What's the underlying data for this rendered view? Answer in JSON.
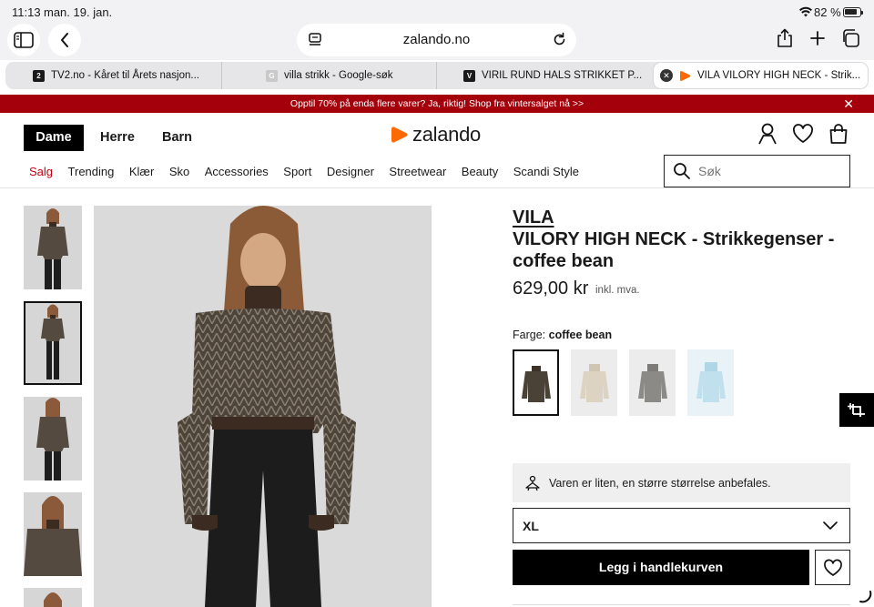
{
  "status": {
    "time": "11:13",
    "date": "man. 19. jan.",
    "battery": "82 %"
  },
  "browser": {
    "url": "zalando.no",
    "tabs": [
      {
        "title": "TV2.no - Kåret til Årets nasjon...",
        "favicon": "2",
        "favicon_color": "#1a1a1a"
      },
      {
        "title": "villa strikk - Google-søk",
        "favicon": "G",
        "favicon_color": "#bdbdbd"
      },
      {
        "title": "VIRIL RUND HALS STRIKKET P...",
        "favicon": "V",
        "favicon_color": "#1a1a1a"
      },
      {
        "title": "VILA VILORY HIGH NECK - Strik...",
        "favicon": "",
        "favicon_color": "#ff6900"
      }
    ]
  },
  "banner": {
    "text": "Opptil 70% på enda flere varer? Ja, riktig! Shop fra vintersalget nå >>",
    "color": "#a4000c"
  },
  "header": {
    "genders": [
      "Dame",
      "Herre",
      "Barn"
    ],
    "logo": "zalando",
    "nav": [
      "Salg",
      "Trending",
      "Klær",
      "Sko",
      "Accessories",
      "Sport",
      "Designer",
      "Streetwear",
      "Beauty",
      "Scandi Style"
    ],
    "search_placeholder": "Søk"
  },
  "product": {
    "brand": "VILA",
    "name": "VILORY HIGH NECK - Strikkegenser - coffee bean",
    "price": "629,00 kr",
    "vat": "inkl. mva.",
    "color_label": "Farge:",
    "color_value": "coffee bean",
    "swatches": [
      {
        "name": "coffee bean",
        "color": "#4b4237"
      },
      {
        "name": "cream",
        "color": "#dcd3c3"
      },
      {
        "name": "grey",
        "color": "#8c8a86"
      },
      {
        "name": "light blue",
        "color": "#bfe0ec"
      }
    ],
    "fit_note": "Varen er liten, en større størrelse anbefales.",
    "size": "XL",
    "cart_button": "Legg i handlekurven"
  }
}
